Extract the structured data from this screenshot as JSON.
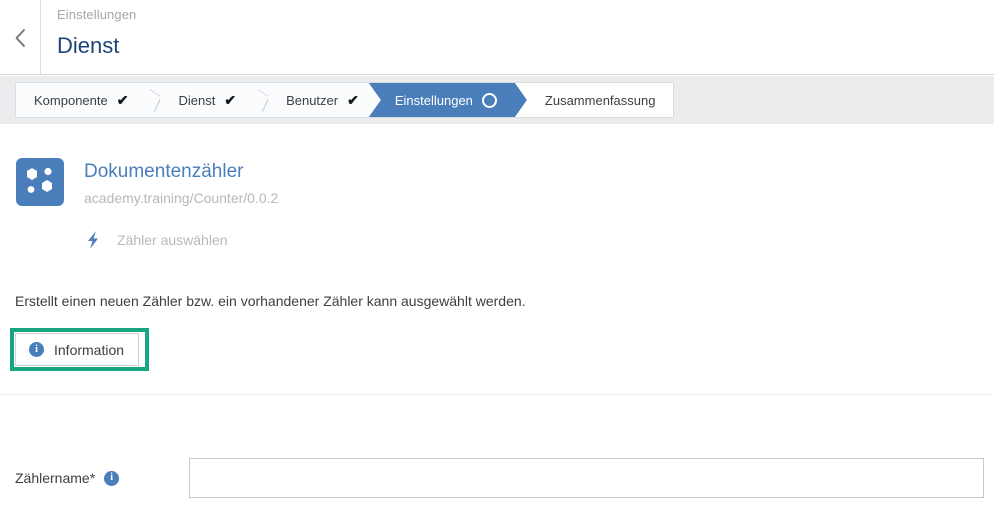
{
  "colors": {
    "accent_blue": "#4a7ebb",
    "title_blue": "#1b4477",
    "highlight_teal": "#16a57f",
    "wizard_bar_bg": "#eaecee",
    "muted_text": "#b4b9bd"
  },
  "header": {
    "back_icon": "chevron-left-icon",
    "breadcrumb": "Einstellungen",
    "title": "Dienst"
  },
  "wizard": {
    "steps": [
      {
        "label": "Komponente",
        "state": "done",
        "indicator": "check-icon"
      },
      {
        "label": "Dienst",
        "state": "done",
        "indicator": "check-icon"
      },
      {
        "label": "Benutzer",
        "state": "done",
        "indicator": "check-icon"
      },
      {
        "label": "Einstellungen",
        "state": "active",
        "indicator": "circle-outline-icon"
      },
      {
        "label": "Zusammenfassung",
        "state": "todo",
        "indicator": ""
      }
    ],
    "check_glyph": "✔"
  },
  "main": {
    "app": {
      "icon": "molecule-app-icon",
      "name": "Dokumentenzähler",
      "version": "academy.training/Counter/0.0.2"
    },
    "select_row": {
      "icon": "lightning-bolt-icon",
      "label": "Zähler auswählen"
    },
    "description": "Erstellt einen neuen Zähler bzw. ein vorhandener Zähler kann ausgewählt werden.",
    "info_button": {
      "icon": "info-icon",
      "label": "Information"
    },
    "form": {
      "label": "Zählername*",
      "info_icon": "info-icon",
      "input_value": "",
      "input_placeholder": ""
    }
  }
}
